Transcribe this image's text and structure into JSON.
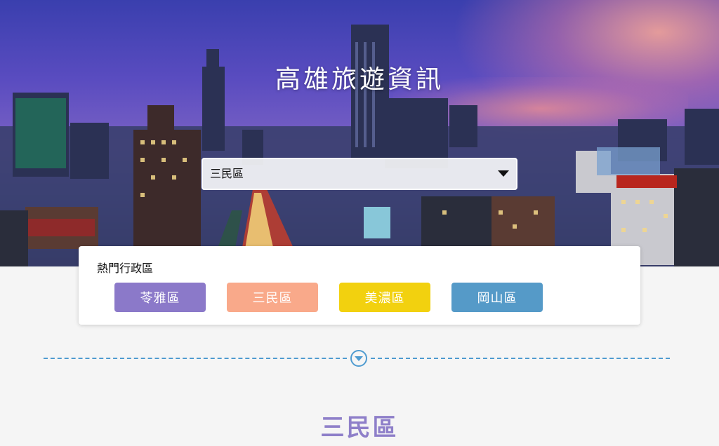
{
  "site": {
    "title": "高雄旅遊資訊"
  },
  "district_select": {
    "selected": "三民區"
  },
  "popular": {
    "title": "熱門行政區",
    "buttons": [
      {
        "label": "苓雅區",
        "color": "#8b79c9"
      },
      {
        "label": "三民區",
        "color": "#f9a98a"
      },
      {
        "label": "美濃區",
        "color": "#f2d10f"
      },
      {
        "label": "岡山區",
        "color": "#559ac8"
      }
    ]
  },
  "result": {
    "heading": "三民區"
  },
  "icons": {
    "dropdown": "caret-down-icon",
    "scroll": "chevron-circle-down-icon"
  }
}
